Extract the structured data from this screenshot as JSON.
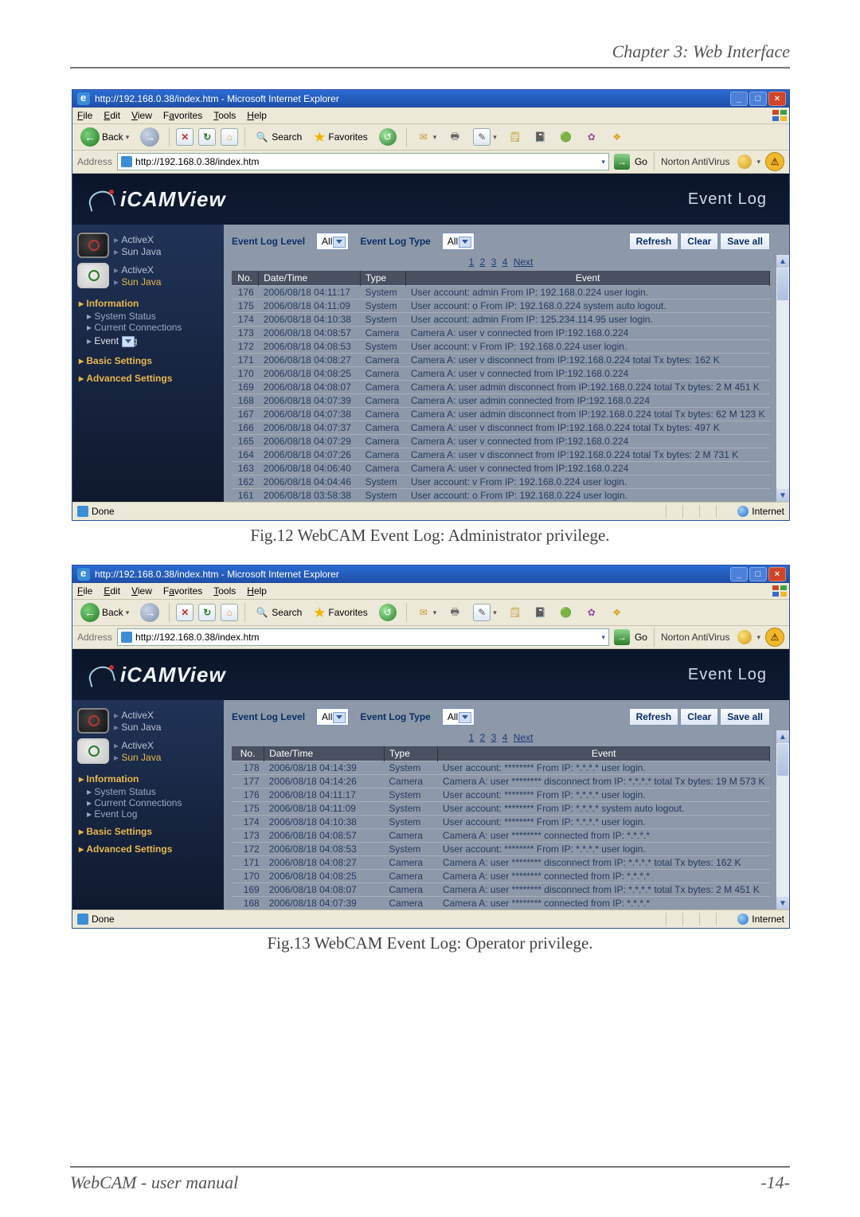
{
  "header": {
    "chapter": "Chapter 3: Web Interface"
  },
  "footer": {
    "left": "WebCAM - user manual",
    "right": "-14-"
  },
  "captions": {
    "fig12": "Fig.12  WebCAM Event Log: Administrator privilege.",
    "fig13": "Fig.13  WebCAM Event Log: Operator privilege."
  },
  "ie": {
    "title_full": "http://192.168.0.38/index.htm - Microsoft Internet Explorer",
    "menu": [
      "File",
      "Edit",
      "View",
      "Favorites",
      "Tools",
      "Help"
    ],
    "toolbar": {
      "back": "Back",
      "search": "Search",
      "favorites": "Favorites"
    },
    "addr": {
      "label": "Address",
      "value": "http://192.168.0.38/index.htm",
      "go": "Go",
      "norton": "Norton AntiVirus"
    },
    "status": {
      "done": "Done",
      "zone": "Internet"
    }
  },
  "cam": {
    "brand": "iCAMView",
    "title": "Event Log",
    "sidebar": {
      "cam1": [
        "ActiveX",
        "Sun Java"
      ],
      "cam2": [
        "ActiveX",
        "Sun Java"
      ],
      "info": "Information",
      "info_sub": [
        "System Status",
        "Current Connections",
        "Event Log"
      ],
      "basic": "Basic Settings",
      "adv": "Advanced Settings"
    },
    "controls": {
      "levelLabel": "Event Log Level",
      "levelValue": "All",
      "typeLabel": "Event Log Type",
      "typeValue": "All",
      "refresh": "Refresh",
      "clear": "Clear",
      "saveall": "Save all"
    },
    "pager": {
      "p1": "1",
      "p2": "2",
      "p3": "3",
      "p4": "4",
      "next": "Next"
    },
    "columns": {
      "no": "No.",
      "dt": "Date/Time",
      "type": "Type",
      "event": "Event"
    }
  },
  "fig12_rows": [
    {
      "no": "176",
      "dt": "2006/08/18 04:11:17",
      "type": "System",
      "ev": "User account: admin From IP: 192.168.0.224 user login."
    },
    {
      "no": "175",
      "dt": "2006/08/18 04:11:09",
      "type": "System",
      "ev": "User account: o From IP: 192.168.0.224 system auto logout."
    },
    {
      "no": "174",
      "dt": "2006/08/18 04:10:38",
      "type": "System",
      "ev": "User account: admin From IP: 125.234.114.95 user login."
    },
    {
      "no": "173",
      "dt": "2006/08/18 04:08:57",
      "type": "Camera",
      "ev": "Camera A: user v connected from IP:192.168.0.224"
    },
    {
      "no": "172",
      "dt": "2006/08/18 04:08:53",
      "type": "System",
      "ev": "User account: v From IP: 192.168.0.224 user login."
    },
    {
      "no": "171",
      "dt": "2006/08/18 04:08:27",
      "type": "Camera",
      "ev": "Camera A: user v disconnect from IP:192.168.0.224 total Tx bytes: 162 K"
    },
    {
      "no": "170",
      "dt": "2006/08/18 04:08:25",
      "type": "Camera",
      "ev": "Camera A: user v connected from IP:192.168.0.224"
    },
    {
      "no": "169",
      "dt": "2006/08/18 04:08:07",
      "type": "Camera",
      "ev": "Camera A: user admin disconnect from IP:192.168.0.224 total Tx bytes: 2 M 451 K"
    },
    {
      "no": "168",
      "dt": "2006/08/18 04:07:39",
      "type": "Camera",
      "ev": "Camera A: user admin connected from IP:192.168.0.224"
    },
    {
      "no": "167",
      "dt": "2006/08/18 04:07:38",
      "type": "Camera",
      "ev": "Camera A: user admin disconnect from IP:192.168.0.224 total Tx bytes: 62 M 123 K"
    },
    {
      "no": "166",
      "dt": "2006/08/18 04:07:37",
      "type": "Camera",
      "ev": "Camera A: user v disconnect from IP:192.168.0.224 total Tx bytes: 497 K"
    },
    {
      "no": "165",
      "dt": "2006/08/18 04:07:29",
      "type": "Camera",
      "ev": "Camera A: user v connected from IP:192.168.0.224"
    },
    {
      "no": "164",
      "dt": "2006/08/18 04:07:26",
      "type": "Camera",
      "ev": "Camera A: user v disconnect from IP:192.168.0.224 total Tx bytes: 2 M 731 K"
    },
    {
      "no": "163",
      "dt": "2006/08/18 04:06:40",
      "type": "Camera",
      "ev": "Camera A: user v connected from IP:192.168.0.224"
    },
    {
      "no": "162",
      "dt": "2006/08/18 04:04:46",
      "type": "System",
      "ev": "User account: v From IP: 192.168.0.224 user login."
    },
    {
      "no": "161",
      "dt": "2006/08/18 03:58:38",
      "type": "System",
      "ev": "User account: o From IP: 192.168.0.224 user login."
    }
  ],
  "fig13_rows": [
    {
      "no": "178",
      "dt": "2006/08/18 04:14:39",
      "type": "System",
      "ev": "User account: ******** From IP: *.*.*.* user login."
    },
    {
      "no": "177",
      "dt": "2006/08/18 04:14:26",
      "type": "Camera",
      "ev": "Camera A: user ******** disconnect from IP: *.*.*.* total Tx bytes: 19 M 573 K"
    },
    {
      "no": "176",
      "dt": "2006/08/18 04:11:17",
      "type": "System",
      "ev": "User account: ******** From IP: *.*.*.* user login."
    },
    {
      "no": "175",
      "dt": "2006/08/18 04:11:09",
      "type": "System",
      "ev": "User account: ******** From IP: *.*.*.* system auto logout."
    },
    {
      "no": "174",
      "dt": "2006/08/18 04:10:38",
      "type": "System",
      "ev": "User account: ******** From IP: *.*.*.* user login."
    },
    {
      "no": "173",
      "dt": "2006/08/18 04:08:57",
      "type": "Camera",
      "ev": "Camera A: user ******** connected from IP: *.*.*.*"
    },
    {
      "no": "172",
      "dt": "2006/08/18 04:08:53",
      "type": "System",
      "ev": "User account: ******** From IP: *.*.*.* user login."
    },
    {
      "no": "171",
      "dt": "2006/08/18 04:08:27",
      "type": "Camera",
      "ev": "Camera A: user ******** disconnect from IP: *.*.*.* total Tx bytes: 162 K"
    },
    {
      "no": "170",
      "dt": "2006/08/18 04:08:25",
      "type": "Camera",
      "ev": "Camera A: user ******** connected from IP: *.*.*.*"
    },
    {
      "no": "169",
      "dt": "2006/08/18 04:08:07",
      "type": "Camera",
      "ev": "Camera A: user ******** disconnect from IP: *.*.*.* total Tx bytes: 2 M 451 K"
    },
    {
      "no": "168",
      "dt": "2006/08/18 04:07:39",
      "type": "Camera",
      "ev": "Camera A: user ******** connected from IP: *.*.*.*"
    }
  ]
}
